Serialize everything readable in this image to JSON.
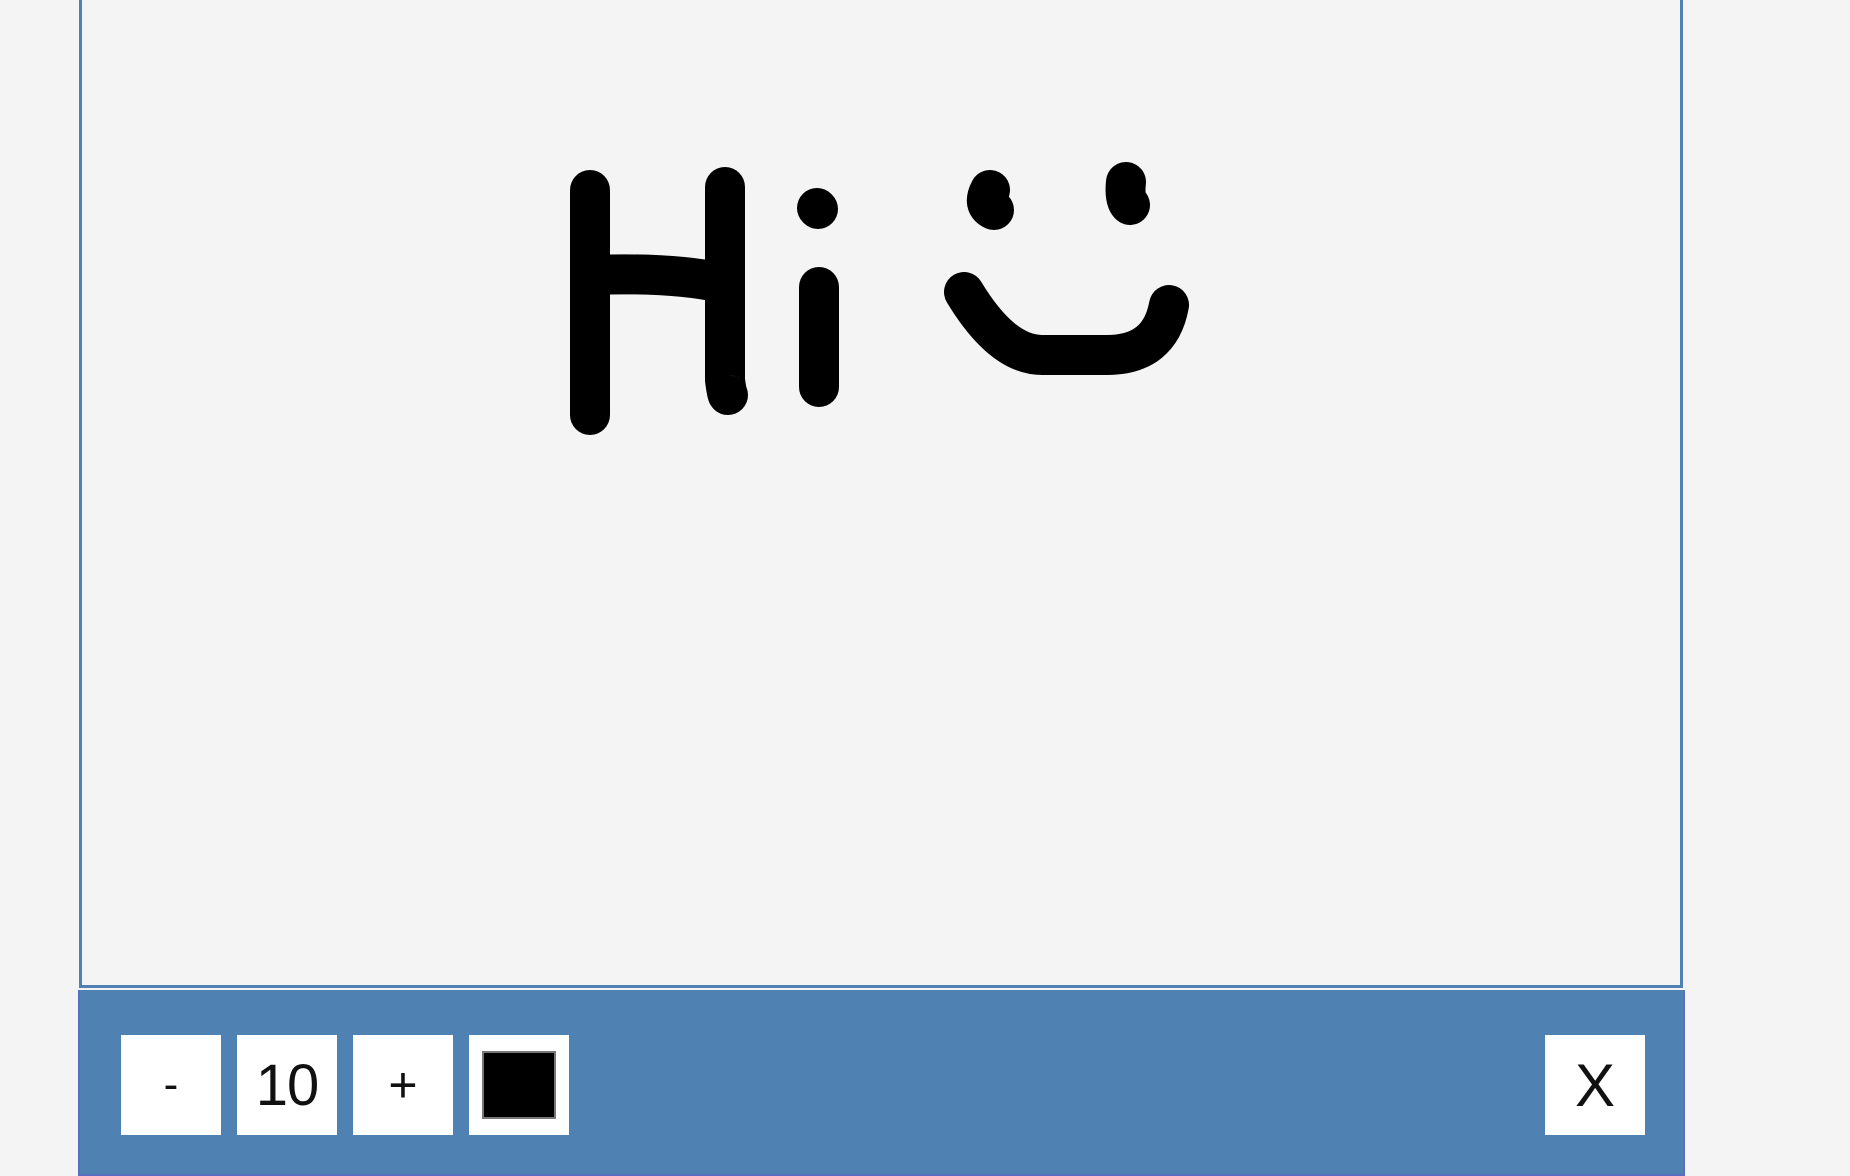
{
  "toolbar": {
    "decrease_label": "-",
    "brush_size": "10",
    "increase_label": "+",
    "current_color": "#000000",
    "close_label": "X"
  },
  "canvas": {
    "background": "#f4f4f4",
    "stroke_color": "#000000"
  },
  "colors": {
    "frame_border": "#4f82b3",
    "toolbar_background": "#4f82b3"
  }
}
